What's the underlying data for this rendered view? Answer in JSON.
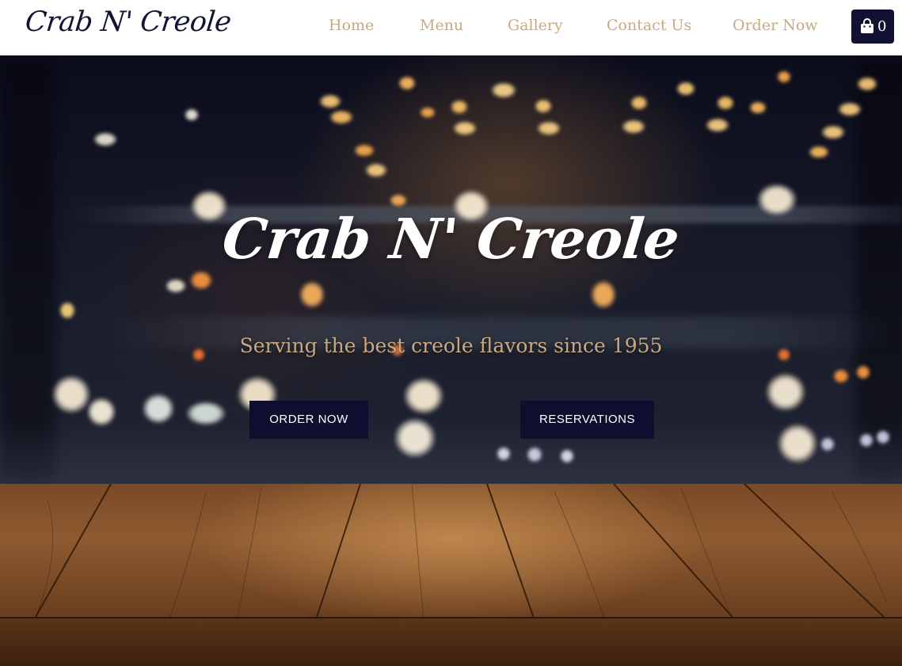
{
  "header": {
    "logo": "Crab N' Creole",
    "nav": [
      "Home",
      "Menu",
      "Gallery",
      "Contact Us",
      "Order Now"
    ],
    "cart": {
      "icon": "shopping-bag-icon",
      "count": "0"
    }
  },
  "hero": {
    "title": "Crab N' Creole",
    "subtitle": "Serving the best creole flavors since 1955",
    "buttons": {
      "order": "ORDER NOW",
      "reservations": "RESERVATIONS"
    }
  },
  "colors": {
    "accent_gold": "#c9a981",
    "navy": "#111133",
    "button_bg": "#0e0f30",
    "header_bg": "#ffffff"
  }
}
